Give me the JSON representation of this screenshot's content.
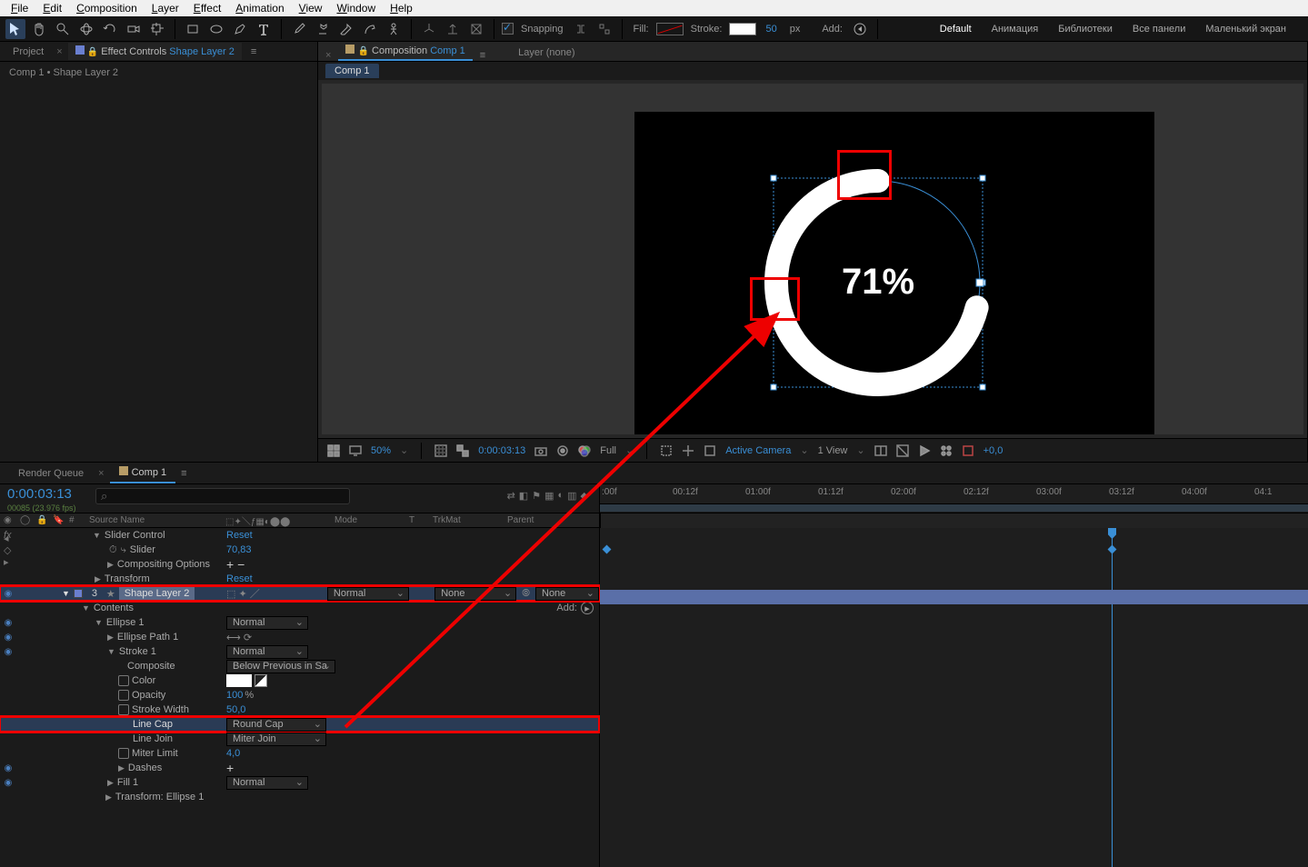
{
  "menu": [
    "File",
    "Edit",
    "Composition",
    "Layer",
    "Effect",
    "Animation",
    "View",
    "Window",
    "Help"
  ],
  "options": {
    "snapping": "Snapping",
    "fill": "Fill:",
    "stroke": "Stroke:",
    "strokeVal": "50",
    "strokeUnit": "px",
    "add": "Add:"
  },
  "workspace": {
    "default": "Default",
    "items": [
      "Анимация",
      "Библиотеки",
      "Все панели",
      "Маленький экран"
    ]
  },
  "leftPanel": {
    "projectTab": "Project",
    "effectTab": "Effect Controls",
    "effectTarget": "Shape Layer 2",
    "lock": "🔒",
    "breadcrumb": "Comp 1 • Shape Layer 2"
  },
  "compPanel": {
    "prefix": "Composition",
    "compName": "Comp 1",
    "layerTab": "Layer (none)",
    "subtab": "Comp 1"
  },
  "preview": {
    "percentText": "71%"
  },
  "footer": {
    "zoom": "50%",
    "timecode": "0:00:03:13",
    "res": "Full",
    "camera": "Active Camera",
    "views": "1 View",
    "exposure": "+0,0"
  },
  "timeline": {
    "renderTab": "Render Queue",
    "compTab": "Comp 1",
    "timecode": "0:00:03:13",
    "frames": "00085 (23.976 fps)",
    "cols": {
      "source": "Source Name",
      "mode": "Mode",
      "t": "T",
      "trkmat": "TrkMat",
      "parent": "Parent"
    },
    "ruler": [
      ":00f",
      "00:12f",
      "01:00f",
      "01:12f",
      "02:00f",
      "02:12f",
      "03:00f",
      "03:12f",
      "04:00f",
      "04:1"
    ],
    "rows": {
      "r0_label": "Slider Control",
      "r0_val": "Reset",
      "r1_label": "Slider",
      "r1_val": "70,83",
      "r2_label": "Compositing Options",
      "r3_label": "Transform",
      "r3_val": "Reset",
      "r4_num": "3",
      "r4_name": "Shape Layer 2",
      "r4_mode": "Normal",
      "r4_trk": "None",
      "r4_parent": "None",
      "r5_label": "Contents",
      "r5_add": "Add:",
      "r6_label": "Ellipse 1",
      "r6_mode": "Normal",
      "r7_label": "Ellipse Path 1",
      "r8_label": "Stroke 1",
      "r8_mode": "Normal",
      "r9_label": "Composite",
      "r9_val": "Below Previous in Sa",
      "r10_label": "Color",
      "r11_label": "Opacity",
      "r11_val": "100",
      "r11_unit": "%",
      "r12_label": "Stroke Width",
      "r12_val": "50,0",
      "r13_label": "Line Cap",
      "r13_val": "Round Cap",
      "r14_label": "Line Join",
      "r14_val": "Miter Join",
      "r15_label": "Miter Limit",
      "r15_val": "4,0",
      "r16_label": "Dashes",
      "r17_label": "Fill 1",
      "r17_mode": "Normal",
      "r18_label": "Transform: Ellipse 1"
    }
  }
}
